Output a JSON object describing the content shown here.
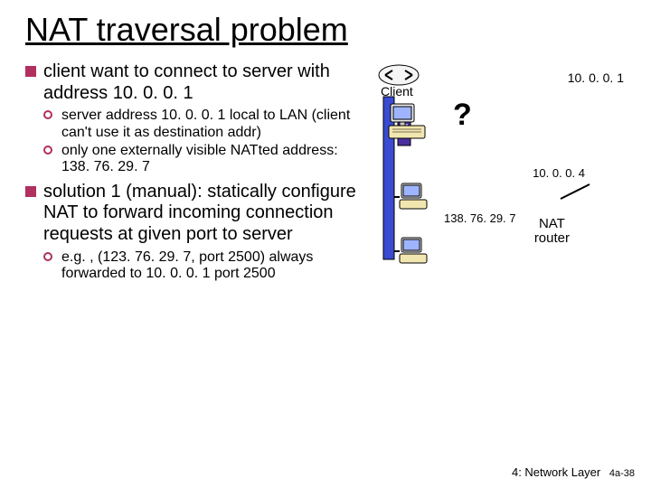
{
  "title": "NAT traversal problem",
  "bullets": {
    "b1a": "client want to connect to server with address 10. 0. 0. 1",
    "b2a": "server address 10. 0. 0. 1 local to LAN (client can't use it as destination addr)",
    "b2b": "only one externally visible NATted address: 138. 76. 29. 7",
    "b1b": "solution 1 (manual): statically configure NAT to forward incoming connection requests at given port to server",
    "b2c": "e.g. , (123. 76. 29. 7, port 2500) always forwarded to 10. 0. 0. 1 port 2500"
  },
  "diagram": {
    "client_label": "Client",
    "question": "?",
    "addr_top": "10. 0. 0. 1",
    "addr_mid": "10. 0. 0. 4",
    "addr_nat": "138. 76. 29. 7",
    "nat_label": "NAT\nrouter"
  },
  "footer": {
    "chapter": "4: Network Layer",
    "page": "4a-38"
  }
}
